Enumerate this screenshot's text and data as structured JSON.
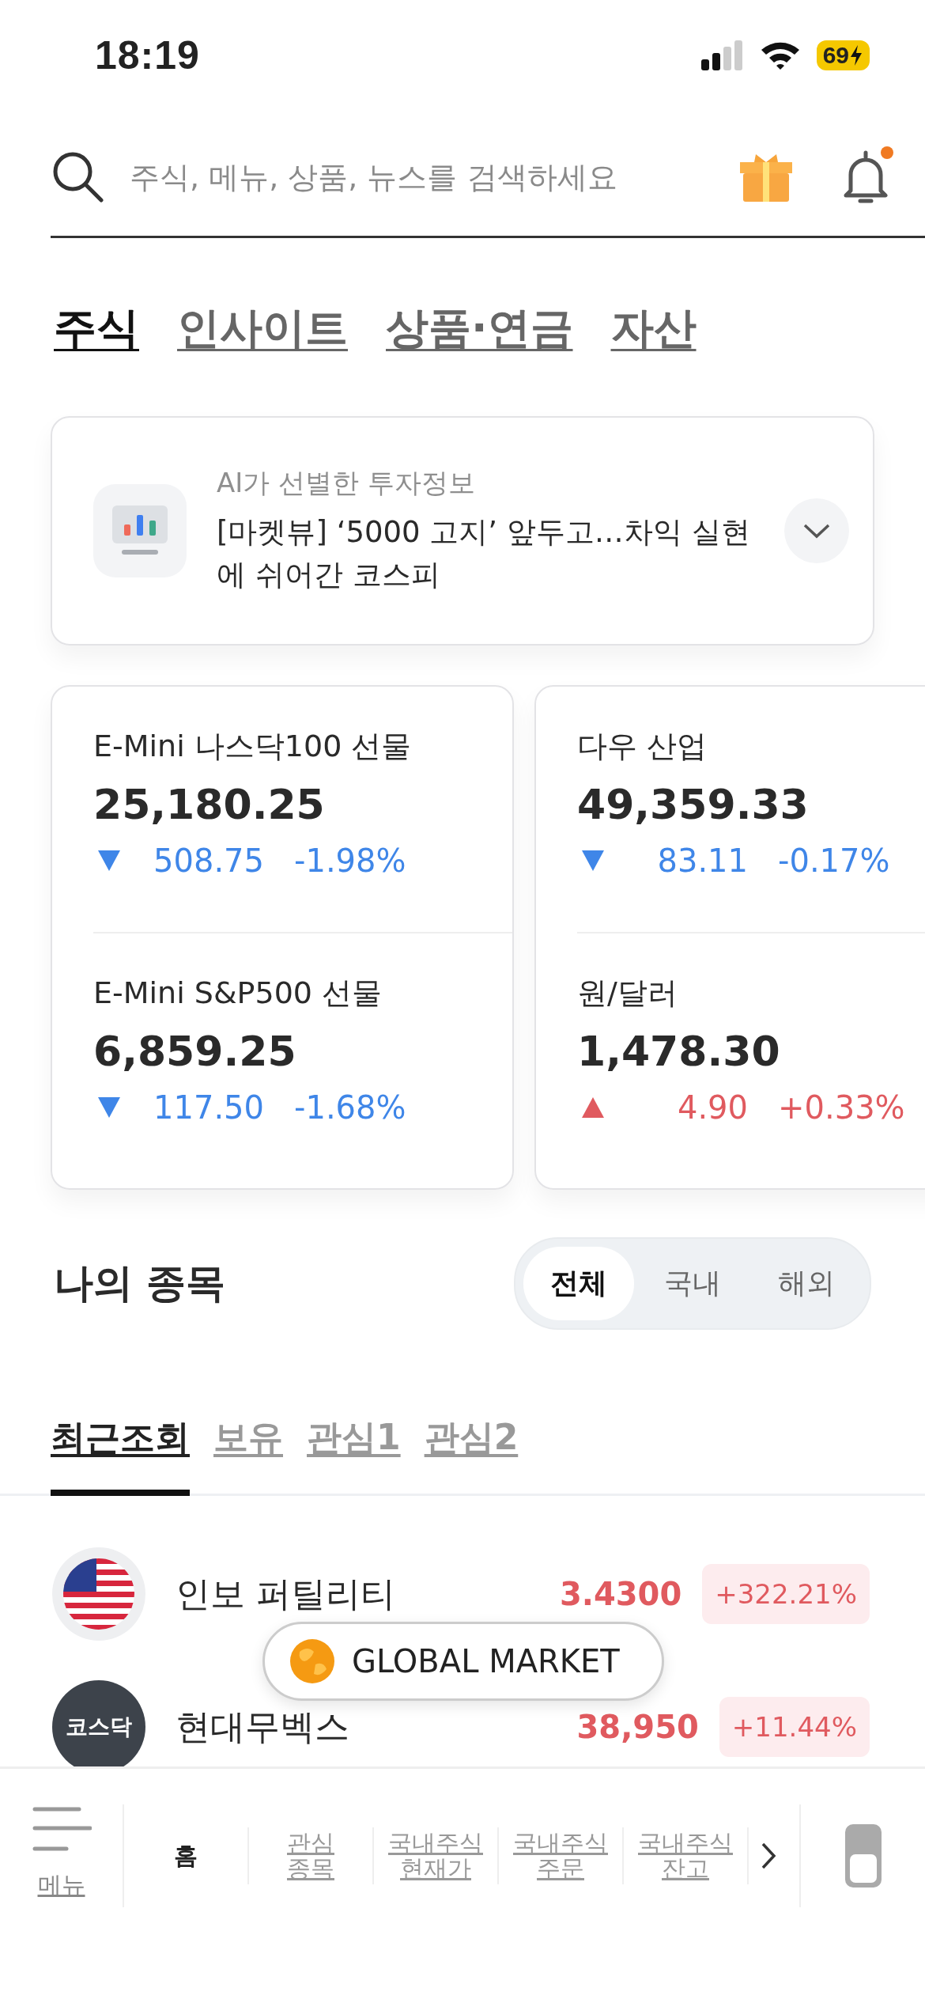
{
  "status_bar": {
    "time": "18:19",
    "battery": "69"
  },
  "search": {
    "placeholder": "주식, 메뉴, 상품, 뉴스를 검색하세요",
    "has_notification": true
  },
  "tabs": [
    {
      "label": "주식",
      "selected": true
    },
    {
      "label": "인사이트",
      "selected": false
    },
    {
      "label": "상품·연금",
      "selected": false
    },
    {
      "label": "자산",
      "selected": false
    }
  ],
  "ai_card": {
    "caption": "AI가 선별한 투자정보",
    "headline": "[마켓뷰] ‘5000 고지’ 앞두고…차익 실현에 쉬어간 코스피"
  },
  "market_cards": [
    {
      "items": [
        {
          "name": "E-Mini 나스닥100 선물",
          "price": "25,180.25",
          "change": "508.75",
          "percent": "-1.98%",
          "rising": false
        },
        {
          "name": "E-Mini S&P500 선물",
          "price": "6,859.25",
          "change": "117.50",
          "percent": "-1.68%",
          "rising": false
        }
      ]
    },
    {
      "items": [
        {
          "name": "다우 산업",
          "price": "49,359.33",
          "change": "83.11",
          "percent": "-0.17%",
          "rising": false
        },
        {
          "name": "원/달러",
          "price": "1,478.30",
          "change": "4.90",
          "percent": "+0.33%",
          "rising": true
        }
      ]
    }
  ],
  "my_stocks": {
    "title": "나의 종목",
    "filters": [
      {
        "label": "전체",
        "selected": true
      },
      {
        "label": "국내",
        "selected": false
      },
      {
        "label": "해외",
        "selected": false
      }
    ],
    "tabs": [
      {
        "label": "최근조회",
        "selected": true
      },
      {
        "label": "보유",
        "selected": false
      },
      {
        "label": "관심1",
        "selected": false
      },
      {
        "label": "관심2",
        "selected": false
      }
    ],
    "rows": [
      {
        "logo": {
          "kind": "flag"
        },
        "name": "인보 퍼틸리티",
        "price": "3.4300",
        "change": "+322.21%",
        "rising": true
      },
      {
        "logo": {
          "kind": "label",
          "text": "코스닥"
        },
        "name": "현대무벡스",
        "price": "38,950",
        "change": "+11.44%",
        "rising": true
      }
    ]
  },
  "floating_button": {
    "label": "GLOBAL MARKET"
  },
  "bottom_nav": {
    "menu_label": "메뉴",
    "items": [
      {
        "label": "홈",
        "selected": true
      },
      {
        "label": "관심\n종목",
        "selected": false
      },
      {
        "label": "국내주식\n현재가",
        "selected": false
      },
      {
        "label": "국내주식\n주문",
        "selected": false
      },
      {
        "label": "국내주식\n잔고",
        "selected": false
      }
    ]
  }
}
